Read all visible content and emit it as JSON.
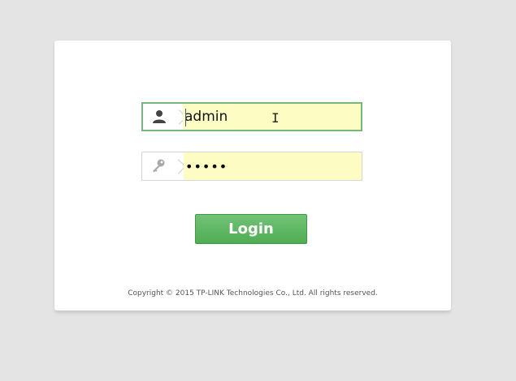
{
  "login_form": {
    "username": {
      "value": "admin",
      "icon": "user-icon"
    },
    "password": {
      "masked_value": "•••••",
      "icon": "key-icon"
    },
    "login_label": "Login"
  },
  "footer": {
    "copyright": "Copyright © 2015 TP-LINK Technologies Co., Ltd. All rights reserved."
  },
  "colors": {
    "background": "#e4e4e4",
    "card": "#ffffff",
    "autofill": "#fcfcc3",
    "focus_border": "#74b87a",
    "button_green": "#4fae53"
  }
}
